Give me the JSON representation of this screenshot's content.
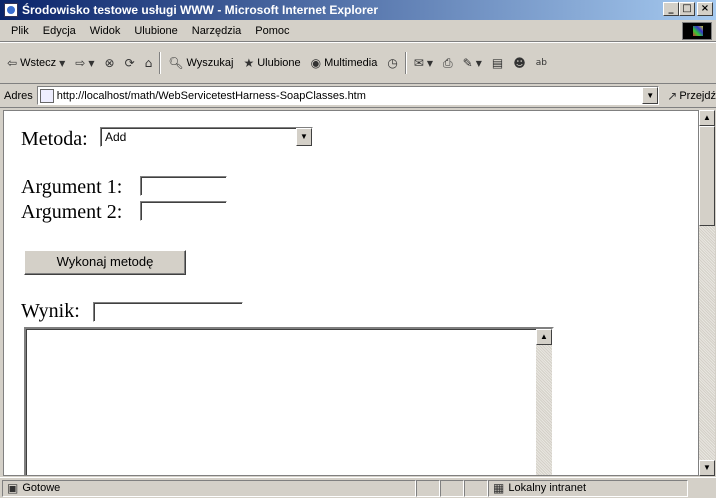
{
  "window": {
    "title": "Środowisko testowe usługi WWW - Microsoft Internet Explorer"
  },
  "menu": [
    "Plik",
    "Edycja",
    "Widok",
    "Ulubione",
    "Narzędzia",
    "Pomoc"
  ],
  "toolbar": {
    "back": "Wstecz",
    "search": "Wyszukaj",
    "favorites": "Ulubione",
    "media": "Multimedia"
  },
  "address": {
    "label": "Adres",
    "url": "http://localhost/math/WebServicetestHarness-SoapClasses.htm",
    "go": "Przejdź"
  },
  "form": {
    "method_label": "Metoda:",
    "method_value": "Add",
    "arg1_label": "Argument 1:",
    "arg2_label": "Argument 2:",
    "execute_button": "Wykonaj metodę",
    "result_label": "Wynik:"
  },
  "status": {
    "text": "Gotowe",
    "zone": "Lokalny intranet"
  }
}
